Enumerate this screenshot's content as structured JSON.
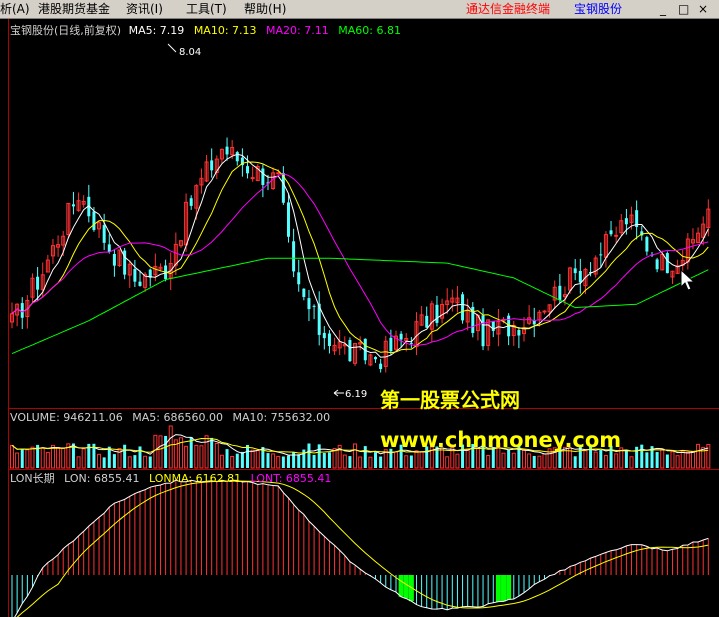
{
  "menu": {
    "items": [
      {
        "label": "析(A)"
      },
      {
        "label": "港股期货基金"
      },
      {
        "label": "资讯(I)"
      },
      {
        "label": "工具(T)"
      },
      {
        "label": "帮助(H)"
      }
    ],
    "brand_text": "通达信金融终端",
    "brand_stock": "宝钢股份",
    "window_buttons": [
      "_",
      "□",
      "×"
    ]
  },
  "colors": {
    "up": "#ff3232",
    "down": "#54ffff",
    "ma5": "#ffffff",
    "ma10": "#ffff00",
    "ma20": "#ff00ff",
    "ma60": "#00ff00",
    "axis": "#b00000",
    "signal": "#00ff00"
  },
  "price_panel": {
    "title": "宝钢股份(日线,前复权)",
    "ma5": "MA5: 7.19",
    "ma10": "MA10: 7.13",
    "ma20": "MA20: 7.11",
    "ma60": "MA60: 6.81",
    "high_label": "8.04",
    "low_label": "6.19"
  },
  "volume_panel": {
    "volume": "VOLUME: 946211.06",
    "ma5": "MA5: 686560.00",
    "ma10": "MA10: 755632.00"
  },
  "lon_panel": {
    "name": "LON长期",
    "lon": "LON: 6855.41",
    "lonma": "LONMA: 6162.81",
    "lont": "LONT: 6855.41"
  },
  "watermark": {
    "line1": "第一股票公式网",
    "line2": "www.chnmoney.com"
  },
  "chart_data": {
    "type": "candlestick",
    "price_range": [
      6.0,
      8.2
    ],
    "close_profile": [
      [
        0,
        6.48
      ],
      [
        6,
        6.8
      ],
      [
        13,
        7.28
      ],
      [
        19,
        6.95
      ],
      [
        24,
        6.75
      ],
      [
        30,
        6.82
      ],
      [
        36,
        7.3
      ],
      [
        41,
        7.55
      ],
      [
        47,
        7.42
      ],
      [
        52,
        7.35
      ],
      [
        55,
        6.75
      ],
      [
        60,
        6.45
      ],
      [
        66,
        6.3
      ],
      [
        72,
        6.28
      ],
      [
        80,
        6.48
      ],
      [
        86,
        6.62
      ],
      [
        92,
        6.42
      ],
      [
        100,
        6.5
      ],
      [
        108,
        6.72
      ],
      [
        116,
        6.95
      ],
      [
        120,
        7.12
      ],
      [
        127,
        6.85
      ],
      [
        132,
        6.92
      ],
      [
        136,
        7.18
      ]
    ],
    "ma60_profile": [
      [
        0,
        6.3
      ],
      [
        15,
        6.5
      ],
      [
        30,
        6.75
      ],
      [
        50,
        6.88
      ],
      [
        62,
        6.88
      ],
      [
        85,
        6.85
      ],
      [
        98,
        6.76
      ],
      [
        110,
        6.58
      ],
      [
        122,
        6.6
      ],
      [
        136,
        6.81
      ]
    ],
    "lon_profile": [
      [
        0,
        -0.7
      ],
      [
        6,
        0.1
      ],
      [
        14,
        0.65
      ],
      [
        20,
        1.05
      ],
      [
        27,
        1.3
      ],
      [
        32,
        1.38
      ],
      [
        45,
        1.38
      ],
      [
        52,
        1.3
      ],
      [
        58,
        0.8
      ],
      [
        66,
        0.2
      ],
      [
        74,
        -0.22
      ],
      [
        80,
        -0.48
      ],
      [
        85,
        -0.5
      ],
      [
        92,
        -0.45
      ],
      [
        98,
        -0.35
      ],
      [
        104,
        -0.05
      ],
      [
        110,
        0.15
      ],
      [
        118,
        0.38
      ],
      [
        122,
        0.45
      ],
      [
        128,
        0.35
      ],
      [
        136,
        0.55
      ]
    ],
    "bars": 137,
    "signal_bars": [
      77,
      96
    ]
  }
}
